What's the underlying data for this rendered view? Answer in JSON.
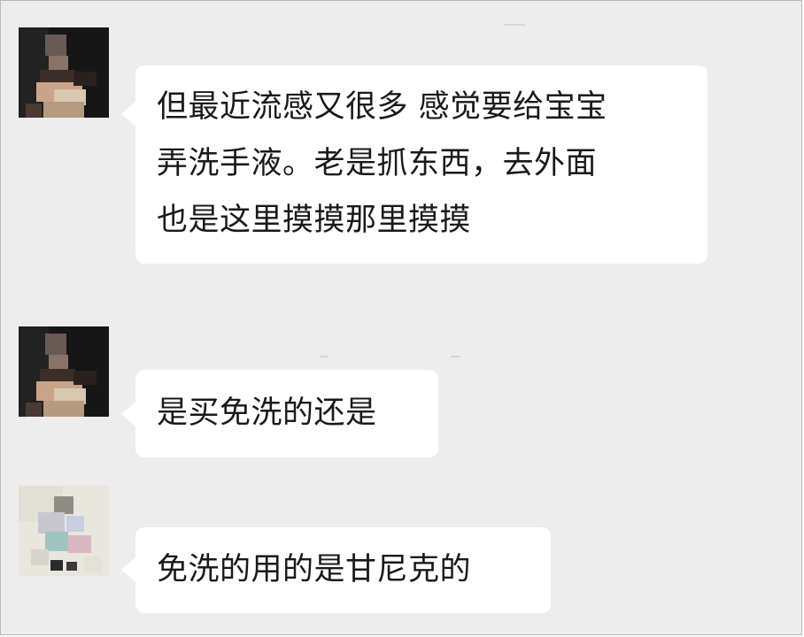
{
  "chat": {
    "messages": [
      {
        "sender": "contact-1",
        "lines": [
          "但最近流感又很多 感觉要给宝宝",
          "弄洗手液。老是抓东西，去外面",
          "也是这里摸摸那里摸摸"
        ]
      },
      {
        "sender": "contact-1",
        "lines": [
          "是买免洗的还是"
        ]
      },
      {
        "sender": "contact-2",
        "lines": [
          "免洗的用的是甘尼克的"
        ]
      }
    ]
  },
  "colors": {
    "background": "#ededed",
    "bubble": "#ffffff",
    "text": "#1a1a1a",
    "frame_border": "#b9b9b9"
  }
}
